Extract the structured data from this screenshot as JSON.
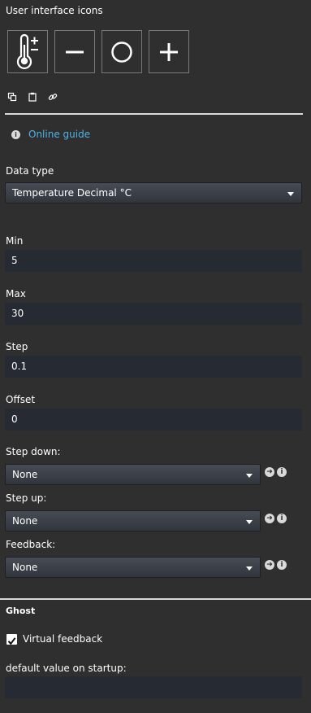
{
  "section": {
    "title": "User interface icons"
  },
  "icon_buttons": [
    {
      "name": "thermometer-plus-minus-icon"
    },
    {
      "name": "minus-icon"
    },
    {
      "name": "circle-icon"
    },
    {
      "name": "plus-icon"
    }
  ],
  "guide": {
    "label": "Online guide"
  },
  "data_type": {
    "label": "Data type",
    "value": "Temperature Decimal °C"
  },
  "min": {
    "label": "Min",
    "value": "5"
  },
  "max": {
    "label": "Max",
    "value": "30"
  },
  "step": {
    "label": "Step",
    "value": "0.1"
  },
  "offset": {
    "label": "Offset",
    "value": "0"
  },
  "step_down": {
    "label": "Step down:",
    "value": "None"
  },
  "step_up": {
    "label": "Step up:",
    "value": "None"
  },
  "feedback": {
    "label": "Feedback:",
    "value": "None"
  },
  "ghost": {
    "title": "Ghost",
    "virtual_feedback": "Virtual feedback",
    "virtual_feedback_checked": true,
    "default_label": "default value on startup:",
    "default_value": ""
  },
  "colors": {
    "background": "#2f2f2f",
    "link": "#4eb3e8",
    "input_bg": "#252a33"
  }
}
